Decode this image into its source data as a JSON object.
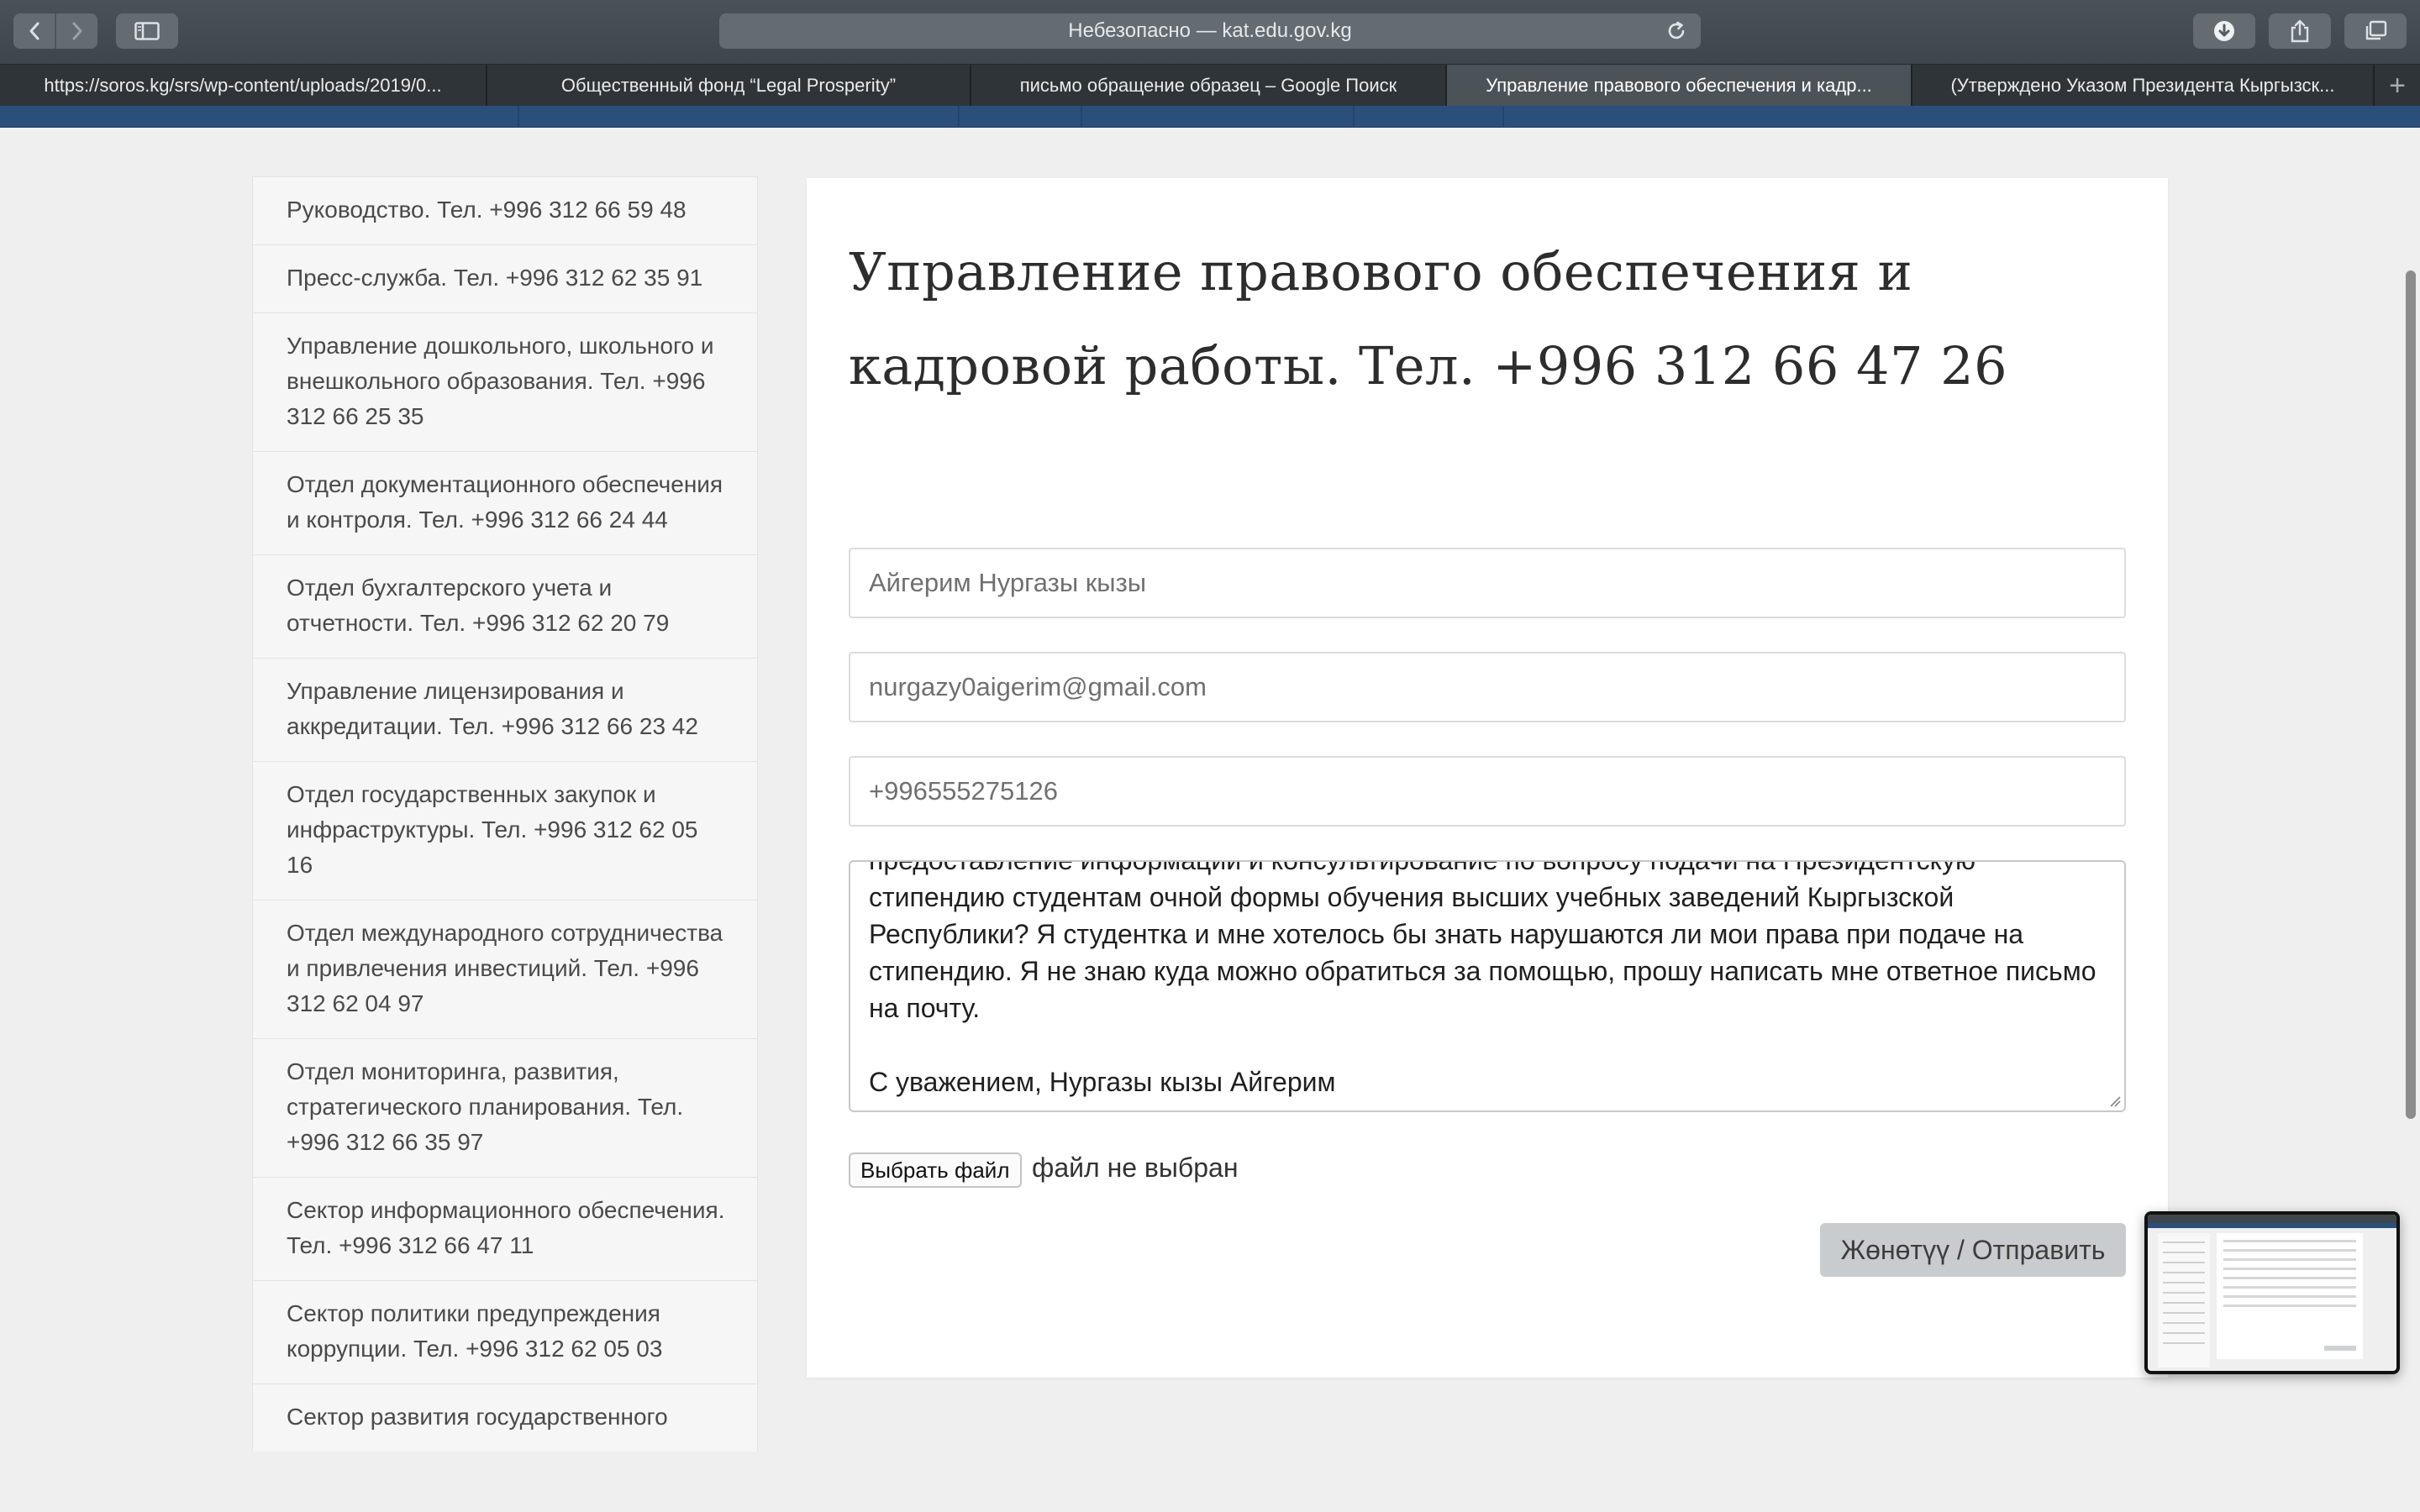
{
  "browser": {
    "address": "Небезопасно — kat.edu.gov.kg",
    "tabs": [
      {
        "label": "https://soros.kg/srs/wp-content/uploads/2019/0...",
        "active": false
      },
      {
        "label": "Общественный фонд “Legal Prosperity”",
        "active": false
      },
      {
        "label": "письмо обращение образец – Google Поиск",
        "active": false
      },
      {
        "label": "Управление правового обеспечения и кадр...",
        "active": true
      },
      {
        "label": "(Утверждено Указом Президента Кыргызск...",
        "active": false
      }
    ],
    "icons": {
      "back": "chevron-left-icon",
      "forward": "chevron-right-icon",
      "sidebar": "sidebar-icon",
      "reload": "reload-icon",
      "download": "download-icon",
      "share": "share-icon",
      "tabs_overview": "tabs-overview-icon",
      "new_tab": "plus-icon"
    }
  },
  "sidebar": {
    "items": [
      "Руководство. Тел. +996 312 66 59 48",
      "Пресс-служба. Тел. +996 312 62 35 91",
      "Управление дошкольного, школьного и внешкольного образования. Тел. +996 312 66 25 35",
      "Отдел документационного обеспечения и контроля. Тел. +996 312 66 24 44",
      "Отдел бухгалтерского учета и отчетности. Тел. +996 312 62 20 79",
      "Управление лицензирования и аккредитации. Тел. +996 312 66 23 42",
      "Отдел государственных закупок и инфраструктуры. Тел. +996 312 62 05 16",
      "Отдел международного сотрудничества и привлечения инвестиций. Тел. +996 312 62 04 97",
      "Отдел мониторинга, развития, стратегического планирования. Тел. +996 312 66 35 97",
      "Сектор информационного обеспечения. Тел. +996 312 66 47 11",
      "Сектор политики предупреждения коррупции. Тел. +996 312 62 05 03",
      "Сектор развития государственного"
    ]
  },
  "form": {
    "title": "Управление правового обеспечения и кадровой работы. Тел. +996 312 66 47 26",
    "name_value": "Айгерим Нургазы кызы",
    "email_value": "nurgazy0aigerim@gmail.com",
    "phone_value": "+996555275126",
    "message_value": "предоставление информации и консультирование по вопросу подачи на Президентскую стипендию студентам очной формы обучения высших учебных заведений Кыргызской Республики? Я студентка и мне хотелось бы знать нарушаются ли мои права при подаче на стипендию. Я не знаю куда можно обратиться за помощью, прошу написать мне ответное письмо на почту.\n\nС уважением, Нургазы кызы Айгерим",
    "file_button": "Выбрать файл",
    "file_status": "файл не выбран",
    "submit": "Жөнөтүү / Отправить"
  },
  "colors": {
    "toolbar": "#4b5257",
    "tab_bar": "#2f3438",
    "active_tab": "#4c5358",
    "page_strip": "#2b4f7b",
    "submit_bg": "#c9ccce"
  }
}
